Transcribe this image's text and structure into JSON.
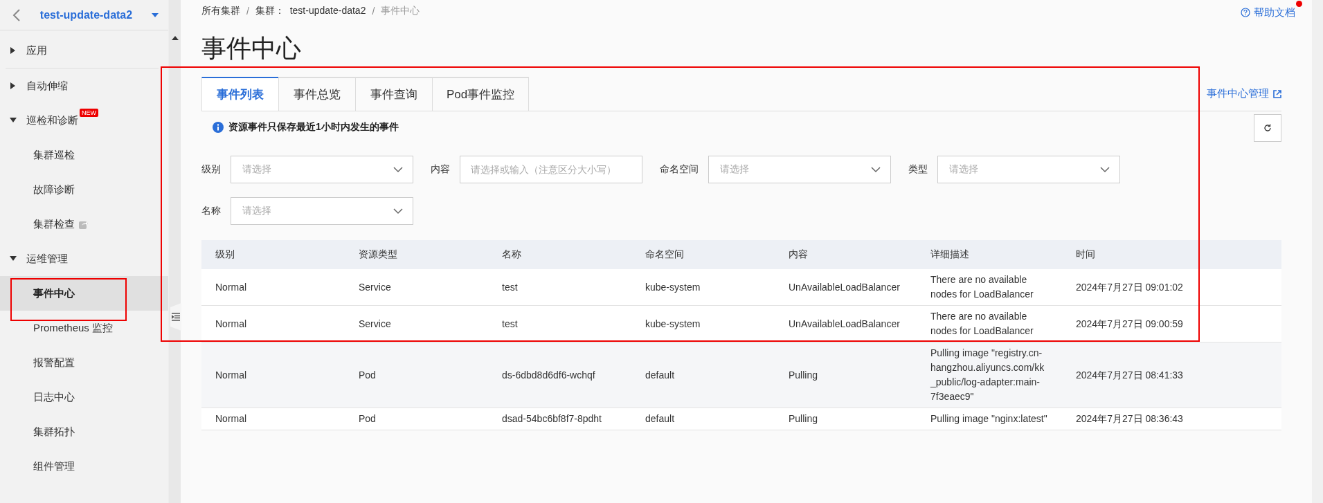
{
  "sidebar": {
    "cluster_name": "test-update-data2",
    "groups": [
      {
        "label": "应用",
        "expanded": false
      },
      {
        "label": "自动伸缩",
        "expanded": false
      },
      {
        "label": "巡检和诊断",
        "expanded": true,
        "badge": "NEW",
        "children": [
          {
            "label": "集群巡检",
            "selected": false
          },
          {
            "label": "故障诊断",
            "selected": false
          },
          {
            "label": "集群检查",
            "selected": false,
            "external": true
          }
        ]
      },
      {
        "label": "运维管理",
        "expanded": true,
        "children": [
          {
            "label": "事件中心",
            "selected": true
          },
          {
            "label": "Prometheus 监控",
            "selected": false
          },
          {
            "label": "报警配置",
            "selected": false
          },
          {
            "label": "日志中心",
            "selected": false
          },
          {
            "label": "集群拓扑",
            "selected": false
          },
          {
            "label": "组件管理",
            "selected": false
          }
        ]
      }
    ]
  },
  "breadcrumb_separator": "/",
  "breadcrumb": [
    {
      "label": "所有集群"
    },
    {
      "label": "集群：  test-update-data2"
    },
    {
      "label": "事件中心"
    }
  ],
  "help_link": {
    "label": "帮助文档",
    "notification": true
  },
  "page_title": "事件中心",
  "tabs": [
    {
      "label": "事件列表",
      "selected": true
    },
    {
      "label": "事件总览",
      "selected": false
    },
    {
      "label": "事件查询",
      "selected": false
    },
    {
      "label": "Pod事件监控",
      "selected": false
    }
  ],
  "manage_link": "事件中心管理",
  "notice": "资源事件只保存最近1小时内发生的事件",
  "filters": [
    {
      "label": "级别",
      "kind": "select",
      "placeholder": "请选择"
    },
    {
      "label": "内容",
      "kind": "input",
      "placeholder": "请选择或输入（注意区分大小写）"
    },
    {
      "label": "命名空间",
      "kind": "select",
      "placeholder": "请选择"
    },
    {
      "label": "类型",
      "kind": "select",
      "placeholder": "请选择"
    },
    {
      "label": "名称",
      "kind": "select",
      "placeholder": "请选择"
    }
  ],
  "table": {
    "columns": [
      "级别",
      "资源类型",
      "名称",
      "命名空间",
      "内容",
      "详细描述",
      "时间"
    ],
    "rows": [
      [
        "Normal",
        "Service",
        "test",
        "kube-system",
        "UnAvailableLoadBalancer",
        "There are no available nodes for LoadBalancer",
        "2024年7月27日 09:01:02"
      ],
      [
        "Normal",
        "Service",
        "test",
        "kube-system",
        "UnAvailableLoadBalancer",
        "There are no available nodes for LoadBalancer",
        "2024年7月27日 09:00:59"
      ],
      [
        "Normal",
        "Pod",
        "ds-6dbd8d6df6-wchqf",
        "default",
        "Pulling",
        "Pulling image \"registry.cn-hangzhou.aliyuncs.com/kk_public/log-adapter:main-7f3eaec9\"",
        "2024年7月27日 08:41:33"
      ],
      [
        "Normal",
        "Pod",
        "dsad-54bc6bf8f7-8pdht",
        "default",
        "Pulling",
        "Pulling image \"nginx:latest\"",
        "2024年7月27日 08:36:43"
      ]
    ]
  },
  "annotations": [
    {
      "kind": "box"
    },
    {
      "kind": "box"
    }
  ]
}
